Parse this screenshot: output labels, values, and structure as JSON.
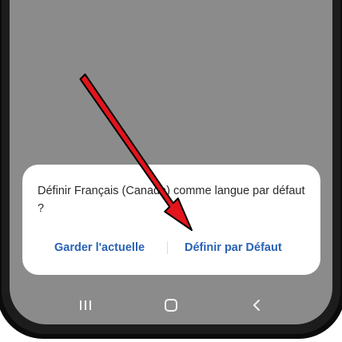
{
  "dialog": {
    "message": "Définir Français (Canada) comme langue par défaut ?",
    "keep_button_label": "Garder l'actuelle",
    "set_default_button_label": "Définir par Défaut"
  },
  "navigation": {
    "recents_icon": "recents-icon",
    "home_icon": "home-icon",
    "back_icon": "back-icon"
  },
  "annotation": {
    "arrow_color": "#e3141b",
    "arrow_outline_color": "#000000"
  },
  "colors": {
    "screen_dim": "#8b8b8b",
    "accent": "#2a62b5",
    "dialog_background": "#ffffff"
  }
}
